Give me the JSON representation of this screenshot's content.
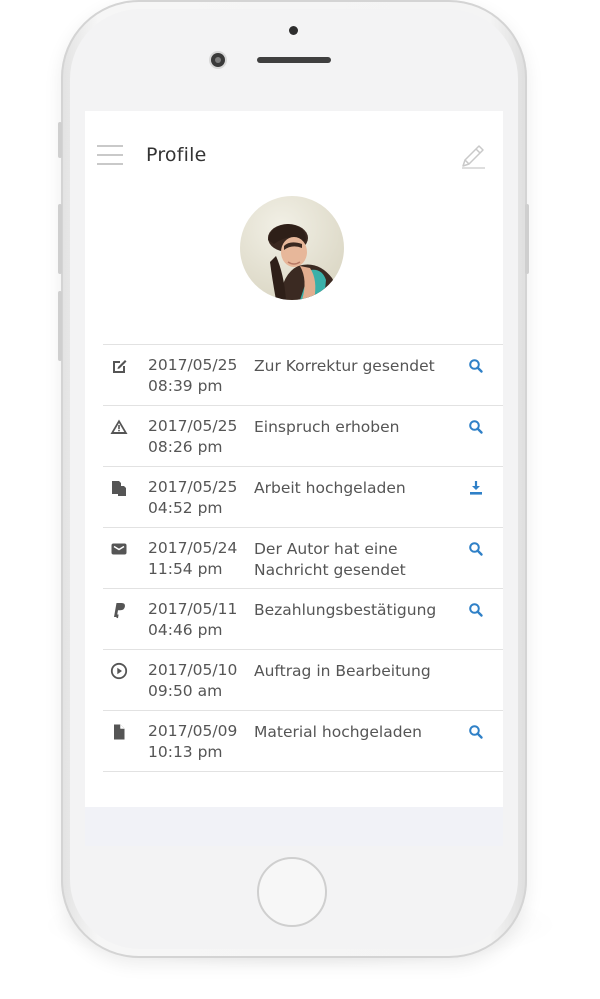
{
  "header": {
    "title": "Profile"
  },
  "icons": {
    "menu": "hamburger-menu-icon",
    "edit": "pencil-icon",
    "search": "magnifier-icon",
    "download": "download-icon"
  },
  "colors": {
    "accent": "#2f80c7",
    "text": "#555555",
    "divider": "#e2e2e2",
    "screen_bg": "#f1f2f7"
  },
  "activity": [
    {
      "date": "2017/05/25",
      "time": "08:39 pm",
      "text": "Zur Korrektur gesendet",
      "icon": "edit-square-icon",
      "action": "search"
    },
    {
      "date": "2017/05/25",
      "time": "08:26 pm",
      "text": "Einspruch erhoben",
      "icon": "warning-icon",
      "action": "search"
    },
    {
      "date": "2017/05/25",
      "time": "04:52 pm",
      "text": "Arbeit hochgeladen",
      "icon": "copy-files-icon",
      "action": "download"
    },
    {
      "date": "2017/05/24",
      "time": "11:54 pm",
      "text": "Der Autor hat eine Nachricht gesendet",
      "icon": "envelope-icon",
      "action": "search"
    },
    {
      "date": "2017/05/11",
      "time": "04:46 pm",
      "text": "Bezahlungsbestätigung",
      "icon": "paypal-icon",
      "action": "search"
    },
    {
      "date": "2017/05/10",
      "time": "09:50 am",
      "text": "Auftrag in Bearbeitung",
      "icon": "play-circle-icon",
      "action": ""
    },
    {
      "date": "2017/05/09",
      "time": "10:13 pm",
      "text": "Material hochgeladen",
      "icon": "file-icon",
      "action": "search"
    }
  ]
}
